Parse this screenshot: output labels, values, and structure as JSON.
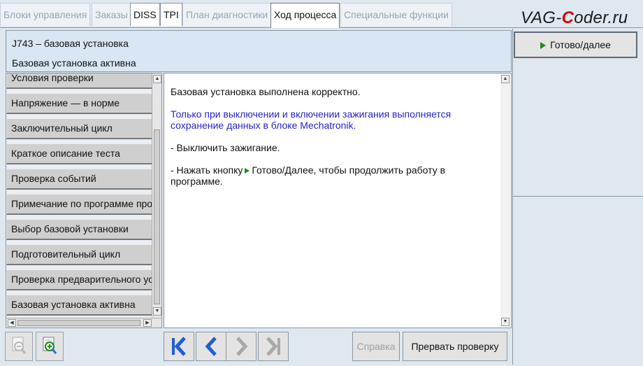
{
  "tabs": [
    {
      "label": "Блоки управления",
      "state": "disabled"
    },
    {
      "label": "Заказы",
      "state": "disabled"
    },
    {
      "label": "DISS",
      "state": "enabled"
    },
    {
      "label": "TPI",
      "state": "enabled"
    },
    {
      "label": "План диагностики",
      "state": "disabled"
    },
    {
      "label": "Ход процесса",
      "state": "active"
    },
    {
      "label": "Специальные функции",
      "state": "disabled"
    }
  ],
  "watermark": {
    "part1": "VAG-",
    "accent": "C",
    "part2": "oder.ru"
  },
  "header": {
    "line1": "J743 – базовая установка",
    "line2": "Базовая установка активна"
  },
  "right_panel": {
    "next_button": "Готово/далее"
  },
  "step_list": [
    "Условия проверки",
    "Напряжение — в норме",
    "Заключительный цикл",
    "Краткое описание теста",
    "Проверка событий",
    "Примечание по программе проверки",
    "Выбор базовой установки",
    "Подготовительный цикл",
    "Проверка предварительного условия",
    "Базовая установка активна"
  ],
  "main": {
    "para1": "Базовая установка выполнена корректно.",
    "para2_line1": "Только при выключении и включении зажигания выполняется",
    "para2_line2": "сохранение данных в блоке Mechatronik.",
    "para3": "- Выключить зажигание.",
    "para4_prefix": "- Нажать кнопку",
    "para4_suffix": "Готово/Далее, чтобы продолжить работу в",
    "para4_line2": "программе."
  },
  "bottom": {
    "help_button": "Справка",
    "abort_button": "Прервать проверку"
  },
  "colors": {
    "accent_blue": "#1e5fd6",
    "text_blue": "#2424c8",
    "green_arrow": "#1c8a1c"
  }
}
